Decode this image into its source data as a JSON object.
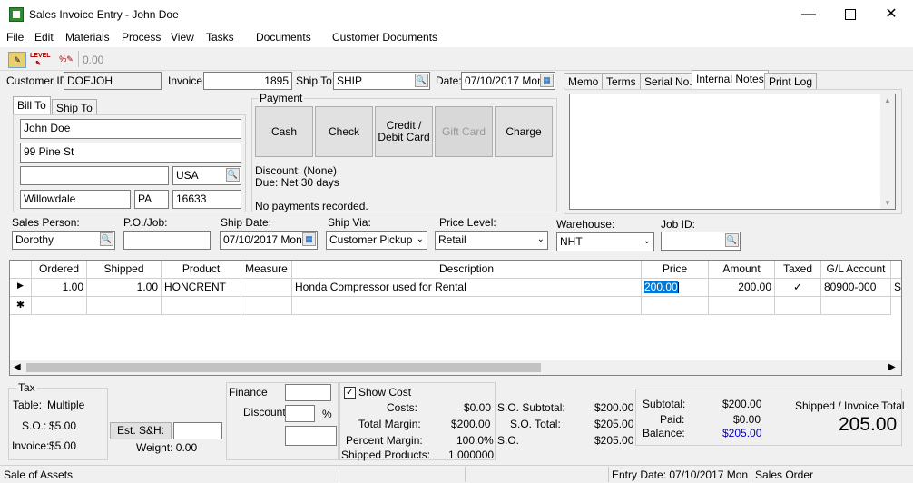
{
  "window": {
    "title": "Sales Invoice Entry - John Doe"
  },
  "menu": [
    "File",
    "Edit",
    "Materials",
    "Process",
    "View",
    "Tasks",
    "Documents",
    "Customer Documents"
  ],
  "toolbar": {
    "value": "0.00",
    "level_label": "LEVEL"
  },
  "header": {
    "customer_id_label": "Customer ID:",
    "customer_id": "DOEJOH",
    "invoice_label": "Invoice:",
    "invoice": "1895",
    "ship_to_label": "Ship To:",
    "ship_to": "SHIP",
    "date_label": "Date:",
    "date": "07/10/2017 Mon"
  },
  "address_tabs": [
    "Bill To",
    "Ship To"
  ],
  "bill_to": {
    "name": "John Doe",
    "street": "99 Pine St",
    "line2": "",
    "country": "USA",
    "city": "Willowdale",
    "state": "PA",
    "zip": "16633"
  },
  "payment": {
    "title": "Payment",
    "buttons": [
      "Cash",
      "Check",
      "Credit /\nDebit Card",
      "Gift Card",
      "Charge"
    ],
    "discount": "Discount: (None)",
    "due": "Due: Net 30  days",
    "status": "No payments recorded."
  },
  "notes_tabs": [
    "Memo",
    "Terms",
    "Serial No.",
    "Internal Notes",
    "Print Log"
  ],
  "order_fields": {
    "sales_person_label": "Sales Person:",
    "sales_person": "Dorothy",
    "po_label": "P.O./Job:",
    "po": "",
    "ship_date_label": "Ship Date:",
    "ship_date": "07/10/2017 Mon",
    "ship_via_label": "Ship Via:",
    "ship_via": "Customer Pickup",
    "price_level_label": "Price Level:",
    "price_level": "Retail",
    "warehouse_label": "Warehouse:",
    "warehouse": "NHT",
    "job_id_label": "Job ID:",
    "job_id": ""
  },
  "grid": {
    "columns": [
      "Ordered",
      "Shipped",
      "Product",
      "Measure",
      "Description",
      "Price",
      "Amount",
      "Taxed",
      "G/L Account"
    ],
    "rows": [
      {
        "ordered": "1.00",
        "shipped": "1.00",
        "product": "HONCRENT",
        "measure": "",
        "description": "Honda Compressor used for Rental",
        "price": "200.00",
        "amount": "200.00",
        "taxed": "✓",
        "gl": "80900-000",
        "extra": "S"
      }
    ],
    "new_row_marker": "✱",
    "current_row_marker": "▶"
  },
  "tax": {
    "title": "Tax",
    "table_label": "Table:",
    "table": "Multiple",
    "so_label": "S.O.:",
    "so": "$5.00",
    "invoice_label": "Invoice:",
    "invoice": "$5.00",
    "est_sh_button": "Est. S&H:",
    "est_sh": "",
    "weight": "Weight: 0.00"
  },
  "finance": {
    "finance_label": "Finance",
    "discount_label": "Discount:",
    "percent": "%"
  },
  "cost": {
    "show_cost_label": "Show Cost",
    "costs_label": "Costs:",
    "costs": "$0.00",
    "total_margin_label": "Total Margin:",
    "total_margin": "$200.00",
    "percent_margin_label": "Percent Margin:",
    "percent_margin": "100.0%",
    "shipped_products_label": "Shipped Products:",
    "shipped_products": "1.000000"
  },
  "so_totals": {
    "subtotal_label": "S.O. Subtotal:",
    "subtotal": "$200.00",
    "total_label": "S.O. Total:",
    "total": "$205.00",
    "so_label": "S.O.",
    "so": "$205.00"
  },
  "totals": {
    "subtotal_label": "Subtotal:",
    "subtotal": "$200.00",
    "paid_label": "Paid:",
    "paid": "$0.00",
    "balance_label": "Balance:",
    "balance": "$205.00",
    "shipped_total_label": "Shipped / Invoice Total",
    "shipped_total": "205.00"
  },
  "status": {
    "left": "Sale of Assets",
    "entry_date": "Entry Date: 07/10/2017 Mon",
    "type": "Sales Order"
  },
  "colors": {
    "accent": "#0078d7",
    "balance": "#0000cc"
  }
}
